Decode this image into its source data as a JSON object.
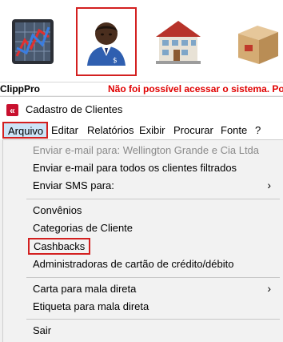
{
  "toolbar": {
    "buttons": [
      {
        "name": "ClippPro",
        "icon": "chart-icon",
        "selected": false
      },
      {
        "name": "Clientes",
        "icon": "client-avatar-icon",
        "selected": true
      },
      {
        "name": "Empresa",
        "icon": "building-icon",
        "selected": false
      },
      {
        "name": "Produtos",
        "icon": "package-icon",
        "selected": false
      }
    ]
  },
  "status": {
    "app_name": "ClippPro",
    "message": "Não foi possível acessar o sistema. Por fav"
  },
  "window": {
    "title": "Cadastro de Clientes",
    "icon": "clipp-logo-icon"
  },
  "menu": {
    "file": "Arquivo",
    "edit": "Editar",
    "reports": "Relatórios",
    "view": "Exibir",
    "search": "Procurar",
    "font": "Fonte",
    "help": "?"
  },
  "dropdown": {
    "send_email": "Enviar e-mail para: Wellington Grande e Cia Ltda",
    "send_email_filtered": "Enviar e-mail para todos os clientes filtrados",
    "send_sms": "Enviar SMS para:",
    "agreements": "Convênios",
    "client_categories": "Categorias de Cliente",
    "cashbacks": "Cashbacks",
    "card_admins": "Administradoras de cartão de crédito/débito",
    "mail_letter": "Carta para mala direta",
    "mail_label": "Etiqueta para mala direta",
    "exit": "Sair",
    "submenu_arrow": "›"
  },
  "colors": {
    "highlight_box": "#d32020",
    "status_error": "#e00000",
    "menu_selected_bg": "#cce4f7",
    "disabled_text": "#8a8a8a"
  }
}
